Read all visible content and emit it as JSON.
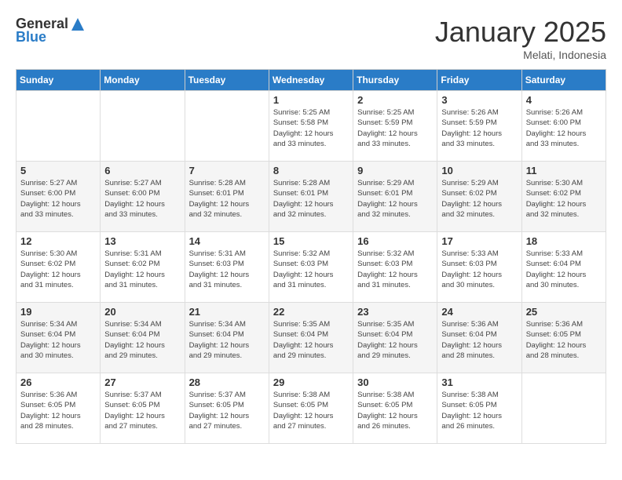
{
  "header": {
    "logo_line1": "General",
    "logo_line2": "Blue",
    "month": "January 2025",
    "location": "Melati, Indonesia"
  },
  "days_of_week": [
    "Sunday",
    "Monday",
    "Tuesday",
    "Wednesday",
    "Thursday",
    "Friday",
    "Saturday"
  ],
  "weeks": [
    [
      {
        "day": "",
        "info": ""
      },
      {
        "day": "",
        "info": ""
      },
      {
        "day": "",
        "info": ""
      },
      {
        "day": "1",
        "info": "Sunrise: 5:25 AM\nSunset: 5:58 PM\nDaylight: 12 hours\nand 33 minutes."
      },
      {
        "day": "2",
        "info": "Sunrise: 5:25 AM\nSunset: 5:59 PM\nDaylight: 12 hours\nand 33 minutes."
      },
      {
        "day": "3",
        "info": "Sunrise: 5:26 AM\nSunset: 5:59 PM\nDaylight: 12 hours\nand 33 minutes."
      },
      {
        "day": "4",
        "info": "Sunrise: 5:26 AM\nSunset: 6:00 PM\nDaylight: 12 hours\nand 33 minutes."
      }
    ],
    [
      {
        "day": "5",
        "info": "Sunrise: 5:27 AM\nSunset: 6:00 PM\nDaylight: 12 hours\nand 33 minutes."
      },
      {
        "day": "6",
        "info": "Sunrise: 5:27 AM\nSunset: 6:00 PM\nDaylight: 12 hours\nand 33 minutes."
      },
      {
        "day": "7",
        "info": "Sunrise: 5:28 AM\nSunset: 6:01 PM\nDaylight: 12 hours\nand 32 minutes."
      },
      {
        "day": "8",
        "info": "Sunrise: 5:28 AM\nSunset: 6:01 PM\nDaylight: 12 hours\nand 32 minutes."
      },
      {
        "day": "9",
        "info": "Sunrise: 5:29 AM\nSunset: 6:01 PM\nDaylight: 12 hours\nand 32 minutes."
      },
      {
        "day": "10",
        "info": "Sunrise: 5:29 AM\nSunset: 6:02 PM\nDaylight: 12 hours\nand 32 minutes."
      },
      {
        "day": "11",
        "info": "Sunrise: 5:30 AM\nSunset: 6:02 PM\nDaylight: 12 hours\nand 32 minutes."
      }
    ],
    [
      {
        "day": "12",
        "info": "Sunrise: 5:30 AM\nSunset: 6:02 PM\nDaylight: 12 hours\nand 31 minutes."
      },
      {
        "day": "13",
        "info": "Sunrise: 5:31 AM\nSunset: 6:02 PM\nDaylight: 12 hours\nand 31 minutes."
      },
      {
        "day": "14",
        "info": "Sunrise: 5:31 AM\nSunset: 6:03 PM\nDaylight: 12 hours\nand 31 minutes."
      },
      {
        "day": "15",
        "info": "Sunrise: 5:32 AM\nSunset: 6:03 PM\nDaylight: 12 hours\nand 31 minutes."
      },
      {
        "day": "16",
        "info": "Sunrise: 5:32 AM\nSunset: 6:03 PM\nDaylight: 12 hours\nand 31 minutes."
      },
      {
        "day": "17",
        "info": "Sunrise: 5:33 AM\nSunset: 6:03 PM\nDaylight: 12 hours\nand 30 minutes."
      },
      {
        "day": "18",
        "info": "Sunrise: 5:33 AM\nSunset: 6:04 PM\nDaylight: 12 hours\nand 30 minutes."
      }
    ],
    [
      {
        "day": "19",
        "info": "Sunrise: 5:34 AM\nSunset: 6:04 PM\nDaylight: 12 hours\nand 30 minutes."
      },
      {
        "day": "20",
        "info": "Sunrise: 5:34 AM\nSunset: 6:04 PM\nDaylight: 12 hours\nand 29 minutes."
      },
      {
        "day": "21",
        "info": "Sunrise: 5:34 AM\nSunset: 6:04 PM\nDaylight: 12 hours\nand 29 minutes."
      },
      {
        "day": "22",
        "info": "Sunrise: 5:35 AM\nSunset: 6:04 PM\nDaylight: 12 hours\nand 29 minutes."
      },
      {
        "day": "23",
        "info": "Sunrise: 5:35 AM\nSunset: 6:04 PM\nDaylight: 12 hours\nand 29 minutes."
      },
      {
        "day": "24",
        "info": "Sunrise: 5:36 AM\nSunset: 6:04 PM\nDaylight: 12 hours\nand 28 minutes."
      },
      {
        "day": "25",
        "info": "Sunrise: 5:36 AM\nSunset: 6:05 PM\nDaylight: 12 hours\nand 28 minutes."
      }
    ],
    [
      {
        "day": "26",
        "info": "Sunrise: 5:36 AM\nSunset: 6:05 PM\nDaylight: 12 hours\nand 28 minutes."
      },
      {
        "day": "27",
        "info": "Sunrise: 5:37 AM\nSunset: 6:05 PM\nDaylight: 12 hours\nand 27 minutes."
      },
      {
        "day": "28",
        "info": "Sunrise: 5:37 AM\nSunset: 6:05 PM\nDaylight: 12 hours\nand 27 minutes."
      },
      {
        "day": "29",
        "info": "Sunrise: 5:38 AM\nSunset: 6:05 PM\nDaylight: 12 hours\nand 27 minutes."
      },
      {
        "day": "30",
        "info": "Sunrise: 5:38 AM\nSunset: 6:05 PM\nDaylight: 12 hours\nand 26 minutes."
      },
      {
        "day": "31",
        "info": "Sunrise: 5:38 AM\nSunset: 6:05 PM\nDaylight: 12 hours\nand 26 minutes."
      },
      {
        "day": "",
        "info": ""
      }
    ]
  ]
}
